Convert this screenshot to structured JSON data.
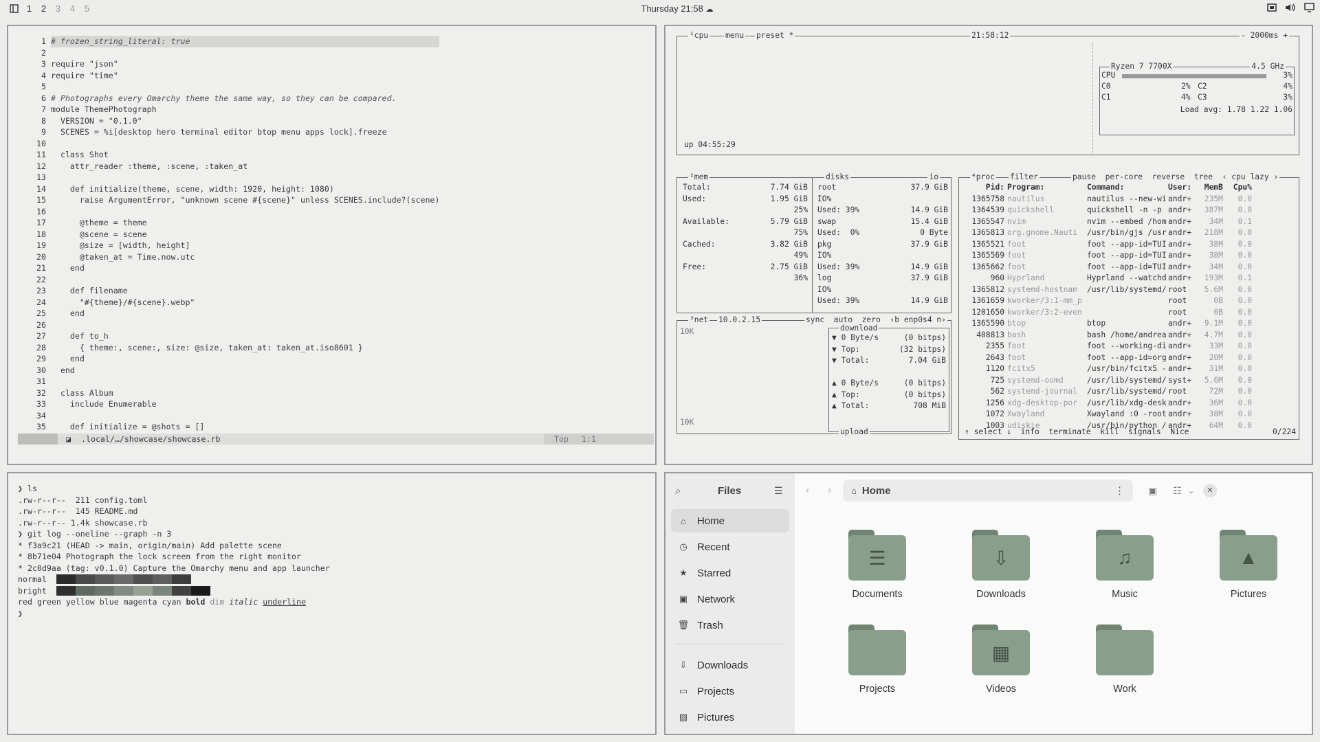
{
  "topbar": {
    "workspaces": [
      "1",
      "2",
      "3",
      "4",
      "5"
    ],
    "clock": "Thursday 21:58"
  },
  "editor": {
    "line_numbers": [
      "1",
      "2",
      "3",
      "4",
      "5",
      "6",
      "7",
      "8",
      "9",
      "10",
      "11",
      "12",
      "13",
      "14",
      "15",
      "16",
      "17",
      "18",
      "19",
      "20",
      "21",
      "22",
      "23",
      "24",
      "25",
      "26",
      "27",
      "28",
      "29",
      "30",
      "31",
      "32",
      "33",
      "34",
      "35"
    ],
    "lines": [
      "# frozen_string_literal: true",
      "",
      "require \"json\"",
      "require \"time\"",
      "",
      "# Photographs every Omarchy theme the same way, so they can be compared.",
      "module ThemePhotograph",
      "  VERSION = \"0.1.0\"",
      "  SCENES = %i[desktop hero terminal editor btop menu apps lock].freeze",
      "",
      "  class Shot",
      "    attr_reader :theme, :scene, :taken_at",
      "",
      "    def initialize(theme, scene, width: 1920, height: 1080)",
      "      raise ArgumentError, \"unknown scene #{scene}\" unless SCENES.include?(scene)",
      "",
      "      @theme = theme",
      "      @scene = scene",
      "      @size = [width, height]",
      "      @taken_at = Time.now.utc",
      "    end",
      "",
      "    def filename",
      "      \"#{theme}/#{scene}.webp\"",
      "    end",
      "",
      "    def to_h",
      "      { theme:, scene:, size: @size, taken_at: taken_at.iso8601 }",
      "    end",
      "  end",
      "",
      "  class Album",
      "    include Enumerable",
      "",
      "    def initialize = @shots = []"
    ],
    "status": {
      "path": ".local/…/showcase/showcase.rb",
      "pos": "Top",
      "cursor": "1:1"
    }
  },
  "btop": {
    "cpu": {
      "header": "¹cpu",
      "menu": "menu",
      "preset": "preset *",
      "time": "21:58:12",
      "interval": "- 2000ms +",
      "uptime": "up 04:55:29",
      "model": "Ryzen 7 7700X",
      "freq": "4.5 GHz",
      "cpu_label": "CPU",
      "cpu_pct": "3%",
      "cores": [
        {
          "name": "C0",
          "pct": "2%"
        },
        {
          "name": "C1",
          "pct": "4%"
        },
        {
          "name": "C2",
          "pct": "4%"
        },
        {
          "name": "C3",
          "pct": "3%"
        }
      ],
      "load": "Load avg: 1.78 1.22 1.06"
    },
    "mem": {
      "header": "²mem",
      "disks_header": "disks",
      "io": "io",
      "rows": [
        [
          "Total:",
          "7.74 GiB"
        ],
        [
          "Used:",
          "1.95 GiB"
        ],
        [
          "",
          "25%"
        ],
        [
          "Available:",
          "5.79 GiB"
        ],
        [
          "",
          "75%"
        ],
        [
          "Cached:",
          "3.82 GiB"
        ],
        [
          "",
          "49%"
        ],
        [
          "Free:",
          "2.75 GiB"
        ],
        [
          "",
          "36%"
        ]
      ],
      "disks": [
        [
          "root",
          "37.9 GiB"
        ],
        [
          "IO%",
          ""
        ],
        [
          "Used: 39%",
          "14.9 GiB"
        ],
        [
          "swap",
          "15.4 GiB"
        ],
        [
          "Used:  0%",
          "0 Byte"
        ],
        [
          "pkg",
          "37.9 GiB"
        ],
        [
          "IO%",
          ""
        ],
        [
          "Used: 39%",
          "14.9 GiB"
        ],
        [
          "log",
          "37.9 GiB"
        ],
        [
          "IO%",
          ""
        ],
        [
          "Used: 39%",
          "14.9 GiB"
        ]
      ]
    },
    "net": {
      "header": "³net",
      "ip": "10.0.2.15",
      "opts": "sync  auto  zero  ‹b enp0s4 n›",
      "scale_top": "10K",
      "scale_bottom": "10K",
      "download_label": "download",
      "upload_label": "upload",
      "down": [
        [
          "▼ 0 Byte/s",
          "(0 bitps)"
        ],
        [
          "▼ Top:",
          "(32 bitps)"
        ],
        [
          "▼ Total:",
          "7.04 GiB"
        ]
      ],
      "up": [
        [
          "▲ 0 Byte/s",
          "(0 bitps)"
        ],
        [
          "▲ Top:",
          "(0 bitps)"
        ],
        [
          "▲ Total:",
          "708 MiB"
        ]
      ]
    },
    "proc": {
      "header": "⁴proc",
      "filter": "filter",
      "opts": "pause  per-core  reverse  tree  ‹ cpu lazy ›",
      "cols": [
        "Pid:",
        "Program:",
        "Command:",
        "User:",
        "MemB",
        "Cpu%"
      ],
      "rows": [
        [
          "1365758",
          "nautilus",
          "nautilus --new-win",
          "andr+",
          "235M",
          "0.0"
        ],
        [
          "1364539",
          "quickshell",
          "quickshell -n -p /",
          "andr+",
          "387M",
          "0.0"
        ],
        [
          "1365547",
          "nvim",
          "nvim --embed /home",
          "andr+",
          "34M",
          "0.1"
        ],
        [
          "1365813",
          "org.gnome.Nauti",
          "/usr/bin/gjs /usr/",
          "andr+",
          "218M",
          "0.0"
        ],
        [
          "1365521",
          "foot",
          "foot --app-id=TUI.",
          "andr+",
          "38M",
          "0.0"
        ],
        [
          "1365569",
          "foot",
          "foot --app-id=TUI.",
          "andr+",
          "38M",
          "0.0"
        ],
        [
          "1365662",
          "foot",
          "foot --app-id=TUI.",
          "andr+",
          "34M",
          "0.0"
        ],
        [
          "960",
          "Hyprland",
          "Hyprland --watchdo",
          "andr+",
          "193M",
          "0.1"
        ],
        [
          "1365812",
          "systemd-hostnam",
          "/usr/lib/systemd/s",
          "root",
          "5.6M",
          "0.0"
        ],
        [
          "1361659",
          "kworker/3:1-mm_p",
          "",
          "root",
          "0B",
          "0.0"
        ],
        [
          "1201650",
          "kworker/3:2-even",
          "",
          "root",
          "0B",
          "0.0"
        ],
        [
          "1365590",
          "btop",
          "btop",
          "andr+",
          "9.1M",
          "0.0"
        ],
        [
          "408813",
          "bash",
          "bash /home/andreas",
          "andr+",
          "4.7M",
          "0.0"
        ],
        [
          "2355",
          "foot",
          "foot --working-dir",
          "andr+",
          "33M",
          "0.0"
        ],
        [
          "2643",
          "foot",
          "foot --app-id=org.",
          "andr+",
          "20M",
          "0.0"
        ],
        [
          "1120",
          "fcitx5",
          "/usr/bin/fcitx5 --",
          "andr+",
          "31M",
          "0.0"
        ],
        [
          "725",
          "systemd-oomd",
          "/usr/lib/systemd/s",
          "syst+",
          "5.6M",
          "0.0"
        ],
        [
          "562",
          "systemd-journal",
          "/usr/lib/systemd/s",
          "root",
          "72M",
          "0.0"
        ],
        [
          "1256",
          "xdg-desktop-por",
          "/usr/lib/xdg-deskt",
          "andr+",
          "36M",
          "0.0"
        ],
        [
          "1072",
          "Xwayland",
          "Xwayland :0 -rootl",
          "andr+",
          "38M",
          "0.0"
        ],
        [
          "1003",
          "udiskie",
          "/usr/bin/python /u",
          "andr+",
          "64M",
          "0.0"
        ]
      ],
      "footer": "↑ select ↓  info  terminate  kill  signals  Nice",
      "count": "0/224"
    }
  },
  "terminal": {
    "lines": [
      "❯ ls",
      ".rw-r--r--  211 config.toml",
      ".rw-r--r--  145 README.md",
      ".rw-r--r-- 1.4k showcase.rb",
      "❯ git log --oneline --graph -n 3",
      "* f3a9c21 (HEAD -> main, origin/main) Add palette scene",
      "* 8b71e04 Photograph the lock screen from the right monitor",
      "* 2c0d9aa (tag: v0.1.0) Capture the Omarchy menu and app launcher"
    ],
    "normal_label": "normal",
    "bright_label": "bright",
    "normal_colors": [
      "#2b2b2b",
      "#4a4a4a",
      "#5a5a5a",
      "#6a6a6a",
      "#4f4f4f",
      "#5e5e5e",
      "#3d3d3d",
      "#efefee"
    ],
    "bright_colors": [
      "#2f2f2f",
      "#5f6a63",
      "#6b776f",
      "#7f8b83",
      "#96a196",
      "#7b857d",
      "#424242",
      "#1a1a1a"
    ],
    "attrs": [
      "red",
      "green",
      "yellow",
      "blue",
      "magenta",
      "cyan",
      "bold",
      "dim",
      "italic",
      "underline"
    ],
    "prompt": "❯"
  },
  "files": {
    "title": "Files",
    "location": "Home",
    "places": [
      "Home",
      "Recent",
      "Starred",
      "Network",
      "Trash"
    ],
    "bookmarks": [
      "Downloads",
      "Projects",
      "Pictures"
    ],
    "folders": [
      {
        "name": "Documents",
        "icon": "document-icon"
      },
      {
        "name": "Downloads",
        "icon": "download-icon"
      },
      {
        "name": "Music",
        "icon": "music-note-icon"
      },
      {
        "name": "Pictures",
        "icon": "image-icon"
      },
      {
        "name": "Projects",
        "icon": "folder-icon"
      },
      {
        "name": "Videos",
        "icon": "film-icon"
      },
      {
        "name": "Work",
        "icon": "folder-icon"
      }
    ]
  }
}
